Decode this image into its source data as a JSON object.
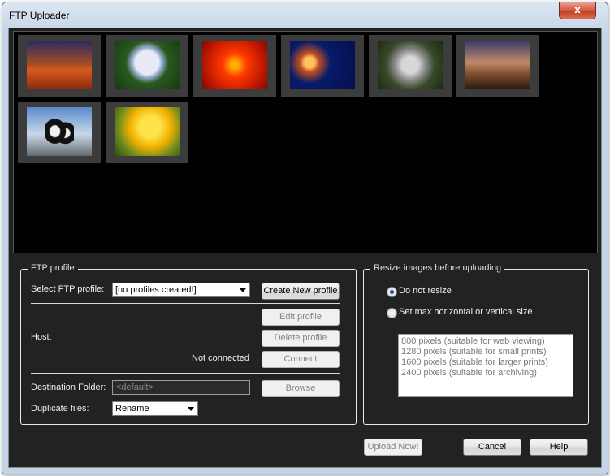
{
  "window": {
    "title": "FTP Uploader",
    "close_glyph": "x"
  },
  "gallery": {
    "thumbnails": [
      {
        "icon": "desert-photo"
      },
      {
        "icon": "hydrangea-photo"
      },
      {
        "icon": "chrysanthemum-photo"
      },
      {
        "icon": "jellyfish-photo"
      },
      {
        "icon": "koala-photo"
      },
      {
        "icon": "lighthouse-photo"
      },
      {
        "icon": "penguins-photo"
      },
      {
        "icon": "tulips-photo"
      }
    ]
  },
  "ftp_profile": {
    "legend": "FTP profile",
    "select_label": "Select FTP profile:",
    "select_value": "[no profiles created!]",
    "create_button": "Create New profile",
    "edit_button": "Edit profile",
    "delete_button": "Delete profile",
    "host_label": "Host:",
    "status_text": "Not connected",
    "connect_button": "Connect",
    "dest_label": "Destination Folder:",
    "dest_placeholder": "<default>",
    "browse_button": "Browse",
    "dup_label": "Duplicate files:",
    "dup_value": "Rename"
  },
  "resize": {
    "legend": "Resize images before uploading",
    "option_no_resize": "Do not resize",
    "option_set_max": "Set max horizontal or vertical size",
    "sizes": [
      "800 pixels (suitable for web viewing)",
      "1280 pixels (suitable for small prints)",
      "1600 pixels (suitable for larger prints)",
      "2400 pixels (suitable for archiving)"
    ]
  },
  "footer": {
    "upload_button": "Upload Now!",
    "cancel_button": "Cancel",
    "help_button": "Help"
  },
  "colors": {
    "panel_background": "#222222",
    "gallery_background": "#000000",
    "thumbnail_frame": "#3c3c3c"
  }
}
